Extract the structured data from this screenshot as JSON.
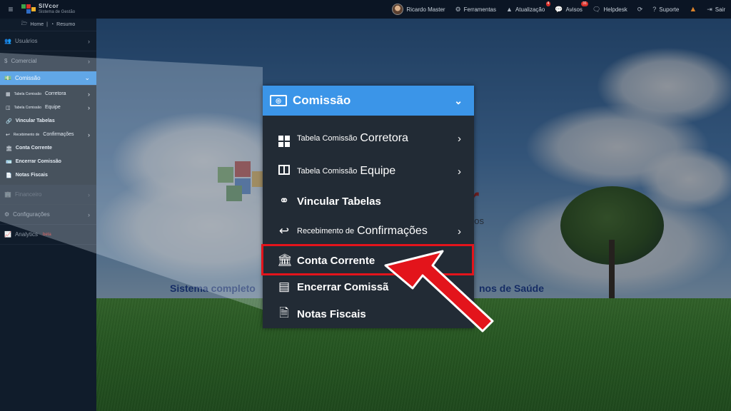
{
  "topbar": {
    "brand_name": "SIVcor",
    "brand_sub": "Sistema de Gestão",
    "user": "Ricardo Master",
    "ferramentas": "Ferramentas",
    "atualizacao": "Atualização",
    "atualizacao_badge": "4",
    "avisos": "Avisos",
    "avisos_badge": "31",
    "helpdesk": "Helpdesk",
    "suporte": "Suporte",
    "sair": "Sair"
  },
  "sidebar": {
    "home": "Home",
    "resumo": "Resumo",
    "items": [
      {
        "label": "Usuários"
      },
      {
        "label": "Comercial"
      },
      {
        "label": "Comissão"
      },
      {
        "label": "Financeiro"
      },
      {
        "label": "Configurações"
      },
      {
        "label": "Analytics"
      }
    ],
    "analytics_badge": "beta",
    "subs": [
      {
        "small": "Tabela Comissão",
        "big": "Corretora"
      },
      {
        "small": "Tabela Comissão",
        "big": "Equipe"
      },
      {
        "label": "Vincular Tabelas"
      },
      {
        "small": "Recebimento de",
        "big": "Confirmações"
      },
      {
        "label": "Conta Corrente"
      },
      {
        "label": "Encerrar Comissão"
      },
      {
        "label": "Notas Fiscais"
      }
    ]
  },
  "background": {
    "brand_letter": "r",
    "brand_tag": "dos",
    "tagline_left": "Sistema completo",
    "tagline_right": "nos de Saúde"
  },
  "zoom": {
    "header": "Comissão",
    "items": [
      {
        "small": "Tabela Comissão",
        "big": "Corretora"
      },
      {
        "small": "Tabela Comissão",
        "big": "Equipe"
      },
      {
        "label": "Vincular Tabelas"
      },
      {
        "small": "Recebimento de",
        "big": "Confirmações"
      },
      {
        "label": "Conta Corrente"
      },
      {
        "label": "Encerrar Comissã"
      },
      {
        "label": "Notas Fiscais"
      }
    ]
  },
  "colors": {
    "accent": "#3b95e8",
    "highlight": "#e3141b",
    "sidebar_bg": "#101c2b",
    "topbar_bg": "#0b1524"
  }
}
